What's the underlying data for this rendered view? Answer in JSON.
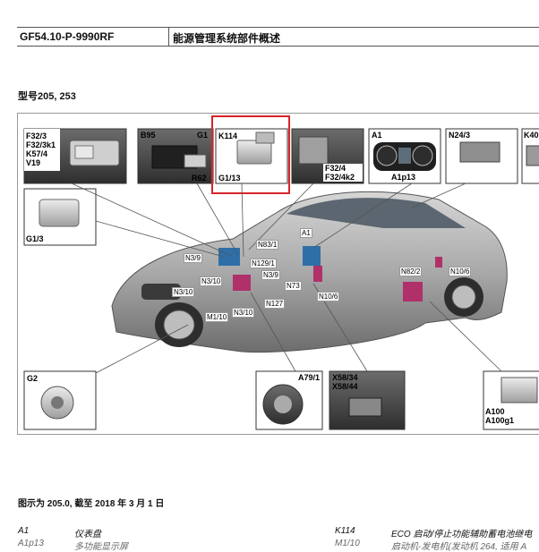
{
  "header": {
    "code": "GF54.10-P-9990RF",
    "title": "能源管理系统部件概述"
  },
  "model_line": "型号205, 253",
  "figure_labels": {
    "f32": "F32/3\nF32/3k1\nK57/4\nV19",
    "b95": "B95",
    "g1": "G1",
    "r62": "R62",
    "k114": "K114",
    "g113": "G1/13",
    "f324": "F32/4\nF32/4k2",
    "a1": "A1",
    "a1p13": "A1p13",
    "n243": "N24/3",
    "k40": "K40",
    "g13": "G1/3",
    "g2": "G2",
    "a791": "A79/1",
    "x58": "X58/34\nX58/44",
    "a100": "A100\nA100g1",
    "n831": "N83/1",
    "n39a": "N3/9",
    "n1291": "N129/1",
    "n310a": "N3/10",
    "n39b": "N3/9",
    "n73": "N73",
    "n310b": "N3/10",
    "m110": "M1/10",
    "n310c": "N3/10",
    "n127": "N127",
    "n106a": "N10/6",
    "n822": "N82/2",
    "n106b": "N10/6",
    "a1car": "A1"
  },
  "caption": "图示为 205.0, 截至 2018 年 3 月 1 日",
  "legend": [
    {
      "code": "A1",
      "desc": "仪表盘"
    },
    {
      "code": "K114",
      "desc": "ECO 启动/停止功能辅助蓄电池继电"
    }
  ],
  "legend_cut": [
    {
      "code": "A1p13",
      "desc": "多功能显示屏"
    },
    {
      "code": "M1/10",
      "desc": "启动机-发电机(发动机 264, 适用 A"
    }
  ],
  "colors": {
    "highlight": "#d9252b",
    "car_body": "#9a9a9a",
    "magenta_component": "#b0306a",
    "blue_component": "#2f6fa8"
  }
}
